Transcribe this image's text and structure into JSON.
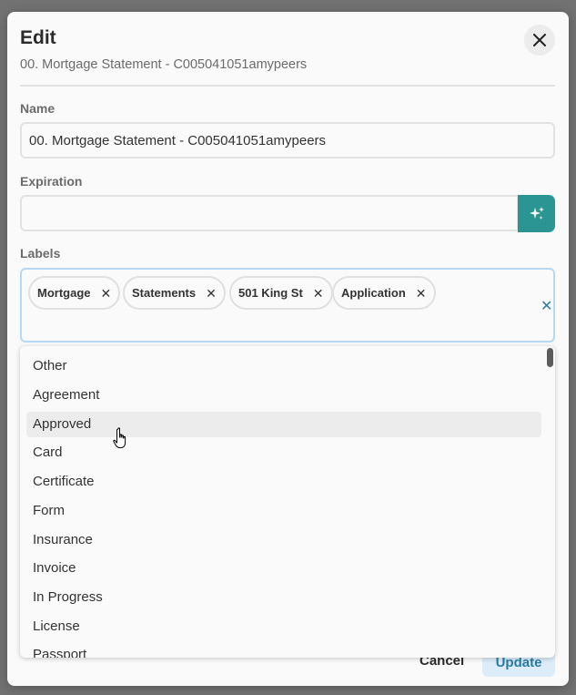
{
  "modal": {
    "title": "Edit",
    "subtitle": "00. Mortgage Statement - C005041051amypeers",
    "close_icon": "close-icon"
  },
  "fields": {
    "name_label": "Name",
    "name_value": "00. Mortgage Statement - C005041051amypeers",
    "expiration_label": "Expiration",
    "expiration_value": "",
    "ai_icon": "sparkle-icon",
    "labels_label": "Labels"
  },
  "labels": {
    "chips": [
      "Mortgage",
      "Statements",
      "501 King St",
      "Application"
    ],
    "clear_icon": "clear-all-icon"
  },
  "dropdown": {
    "options": [
      "Other",
      "Agreement",
      "Approved",
      "Card",
      "Certificate",
      "Form",
      "Insurance",
      "Invoice",
      "In Progress",
      "License",
      "Passport"
    ],
    "hovered": "Approved"
  },
  "footer": {
    "cancel_label": "Cancel",
    "update_label": "Update"
  },
  "colors": {
    "accent_teal": "#2a9592",
    "accent_blue": "#2a7ba5",
    "focus_border": "#b5d8f4"
  }
}
